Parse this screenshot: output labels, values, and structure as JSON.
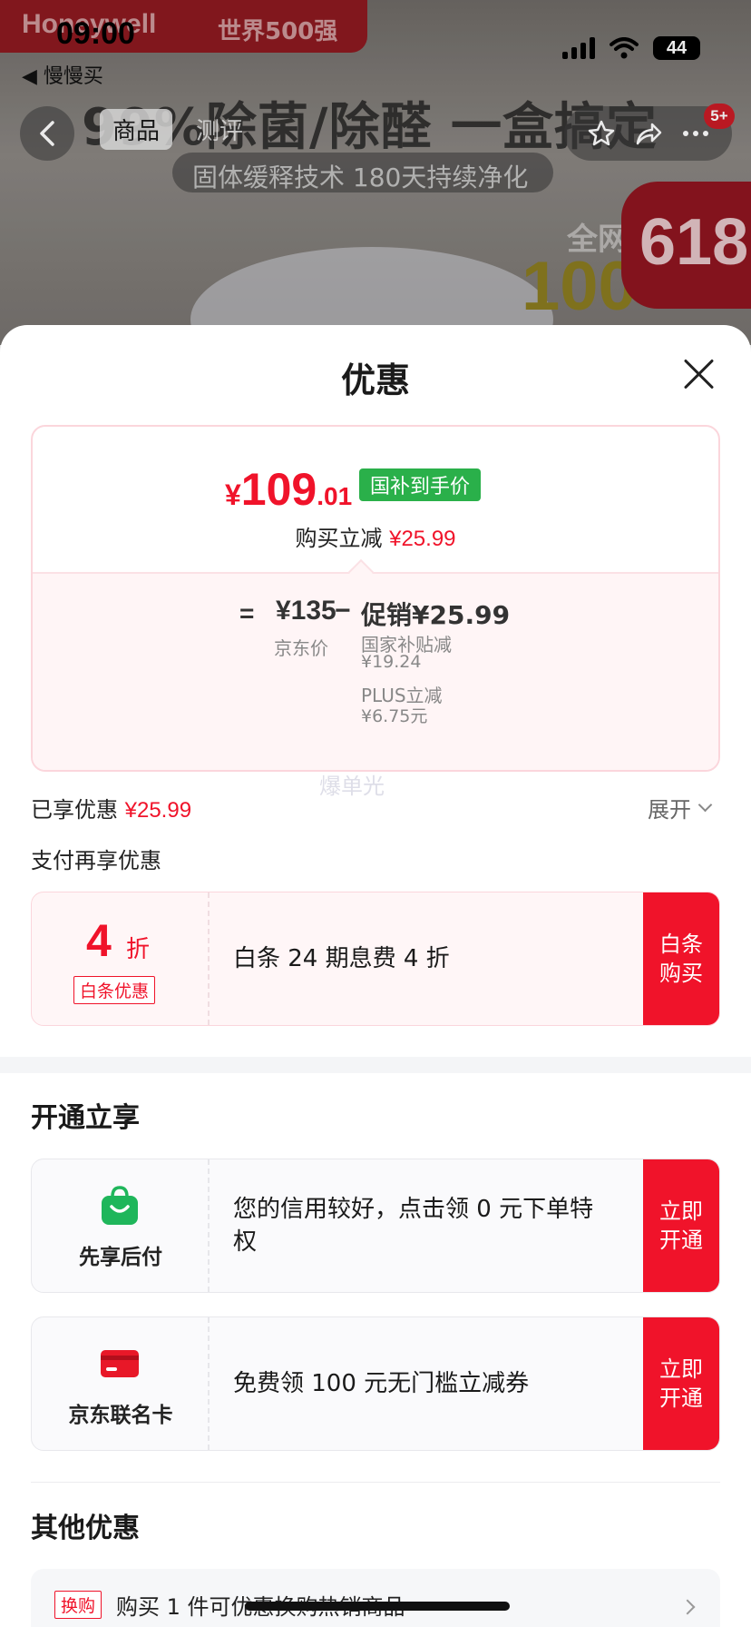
{
  "background": {
    "brand": "Honeywell",
    "brand_tag": "世界500强",
    "headline": "99%除菌/除醛 一盒搞定",
    "subline": "固体缓释技术 180天持续净化",
    "promo_badge": "618",
    "promo_text": "全网",
    "promo_number": "100"
  },
  "status_bar": {
    "time": "09:00",
    "battery": "44",
    "back_app": "◀ 慢慢买"
  },
  "nav": {
    "tabs": [
      {
        "label": "商品"
      },
      {
        "label": "测评"
      }
    ],
    "badge": "5+"
  },
  "sheet": {
    "title": "优惠",
    "price": {
      "currency": "¥",
      "integer": "109",
      "decimal": ".01",
      "tag": "国补到手价"
    },
    "instant": {
      "label": "购买立减",
      "amount": "¥25.99"
    },
    "formula": {
      "equals": "=",
      "jd_price": "¥135",
      "jd_label": "京东价",
      "minus": "−",
      "promo": "促销¥25.99",
      "items": [
        {
          "label": "国家补贴减",
          "amount": "¥19.24"
        },
        {
          "label": "PLUS立减",
          "amount": "¥6.75元"
        }
      ]
    },
    "watermark": "爆单光",
    "enjoyed": {
      "label": "已享优惠",
      "amount": "¥25.99"
    },
    "expand_label": "展开",
    "pay_more_title": "支付再享优惠",
    "baitiao": {
      "discount_num": "4",
      "discount_unit": "折",
      "tag": "白条优惠",
      "text": "白条 24 期息费 4 折",
      "button": "白条购买"
    },
    "open_section_title": "开通立享",
    "services": [
      {
        "name": "先享后付",
        "icon": "shopping-bag-icon",
        "text": "您的信用较好，点击领 0 元下单特权",
        "button": "立即开通"
      },
      {
        "name": "京东联名卡",
        "icon": "credit-card-icon",
        "text": "免费领 100 元无门槛立减券",
        "button": "立即开通"
      }
    ],
    "other_title": "其他优惠",
    "other": {
      "tag": "换购",
      "text": "购买 1 件可优惠换购热销商品"
    }
  },
  "colors": {
    "accent": "#f0132a",
    "green": "#2ab04a"
  }
}
